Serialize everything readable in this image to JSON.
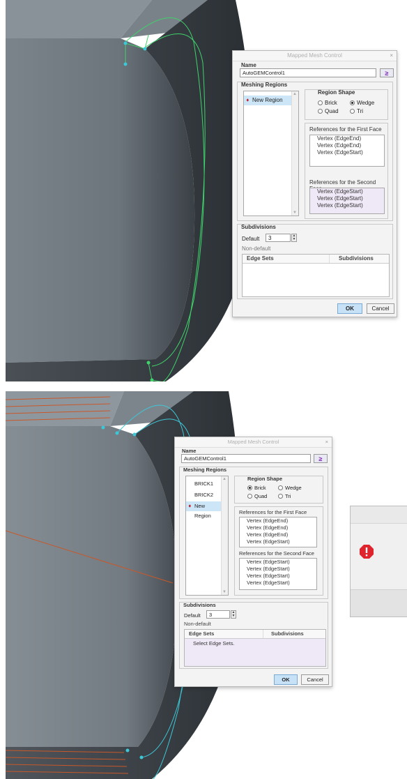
{
  "dialog1": {
    "title": "Mapped Mesh Control",
    "close_glyph": "×",
    "name_label": "Name",
    "name_value": "AutoGEMControl1",
    "meshing_regions_label": "Meshing Regions",
    "regions": [
      {
        "label": "New Region",
        "selected": true,
        "marked": true
      }
    ],
    "region_shape_label": "Region Shape",
    "shapes": [
      {
        "label": "Brick",
        "selected": false
      },
      {
        "label": "Wedge",
        "selected": true
      },
      {
        "label": "Quad",
        "selected": false
      },
      {
        "label": "Tri",
        "selected": false
      }
    ],
    "first_face_label": "References for the First Face",
    "first_face_refs": [
      "Vertex (EdgeEnd)",
      "Vertex (EdgeEnd)",
      "Vertex (EdgeStart)"
    ],
    "second_face_label": "References for the Second Face",
    "second_face_refs": [
      "Vertex (EdgeStart)",
      "Vertex (EdgeStart)",
      "Vertex (EdgeStart)"
    ],
    "subdivisions_label": "Subdivisions",
    "default_label": "Default",
    "default_value": "3",
    "nondefault_label": "Non-default",
    "edge_sets_header": "Edge Sets",
    "subdivisions_header": "Subdivisions",
    "edge_rows": [],
    "ok_label": "OK",
    "cancel_label": "Cancel"
  },
  "dialog2": {
    "title": "Mapped Mesh Control",
    "close_glyph": "×",
    "name_label": "Name",
    "name_value": "AutoGEMControl1",
    "meshing_regions_label": "Meshing Regions",
    "regions": [
      {
        "label": "BRICK1",
        "selected": false,
        "marked": false
      },
      {
        "label": "BRICK2",
        "selected": false,
        "marked": false
      },
      {
        "label": "New Region",
        "selected": true,
        "marked": true
      }
    ],
    "region_shape_label": "Region Shape",
    "shapes": [
      {
        "label": "Brick",
        "selected": true
      },
      {
        "label": "Wedge",
        "selected": false
      },
      {
        "label": "Quad",
        "selected": false
      },
      {
        "label": "Tri",
        "selected": false
      }
    ],
    "first_face_label": "References for the First Face",
    "first_face_refs": [
      "Vertex (EdgeEnd)",
      "Vertex (EdgeEnd)",
      "Vertex (EdgeEnd)",
      "Vertex (EdgeStart)"
    ],
    "second_face_label": "References for the Second Face",
    "second_face_refs": [
      "Vertex (EdgeStart)",
      "Vertex (EdgeStart)",
      "Vertex (EdgeStart)",
      "Vertex (EdgeStart)"
    ],
    "subdivisions_label": "Subdivisions",
    "default_label": "Default",
    "default_value": "3",
    "nondefault_label": "Non-default",
    "edge_sets_header": "Edge Sets",
    "subdivisions_header": "Subdivisions",
    "edge_rows": [
      "Select Edge Sets."
    ],
    "ok_label": "OK",
    "cancel_label": "Cancel"
  },
  "icons": {
    "region_marker": "arrow-marker-icon",
    "name_button": "selection-arrow-icon",
    "alert": "error-icon"
  },
  "colors": {
    "accent_selection": "#cde6f7",
    "ok_button": "#c7e1f7",
    "marker_red": "#c0121c",
    "error_red": "#e0242e",
    "model_gray": "#5f6770",
    "mesh_green": "#3fd36b",
    "mesh_cyan": "#3ec7d6",
    "brick_orange": "#c8582a"
  }
}
